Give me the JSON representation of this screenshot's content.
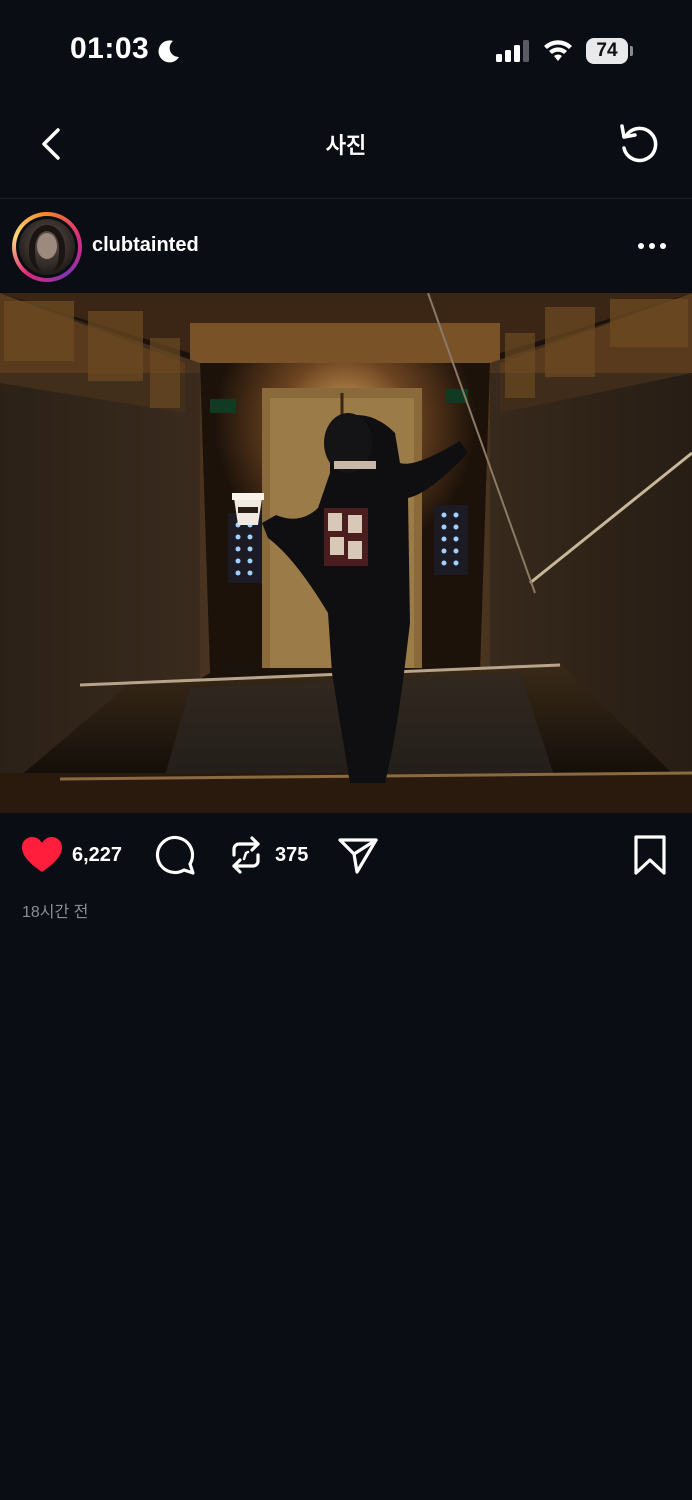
{
  "status_bar": {
    "time": "01:03",
    "battery": "74",
    "icons": [
      "moon-icon",
      "signal-icon",
      "wifi-icon",
      "battery-icon"
    ]
  },
  "nav": {
    "title": "사진",
    "back_icon": "chevron-left-icon",
    "refresh_icon": "refresh-icon"
  },
  "post": {
    "username": "clubtainted",
    "more_icon": "more-horizontal-icon",
    "photo_alt": "photo",
    "likes": "6,227",
    "reposts": "375",
    "timestamp": "18시간 전",
    "liked": true,
    "accent_color": "#ff1f3d",
    "icons": [
      "heart-icon",
      "comment-icon",
      "repost-icon",
      "send-icon",
      "bookmark-icon"
    ]
  }
}
